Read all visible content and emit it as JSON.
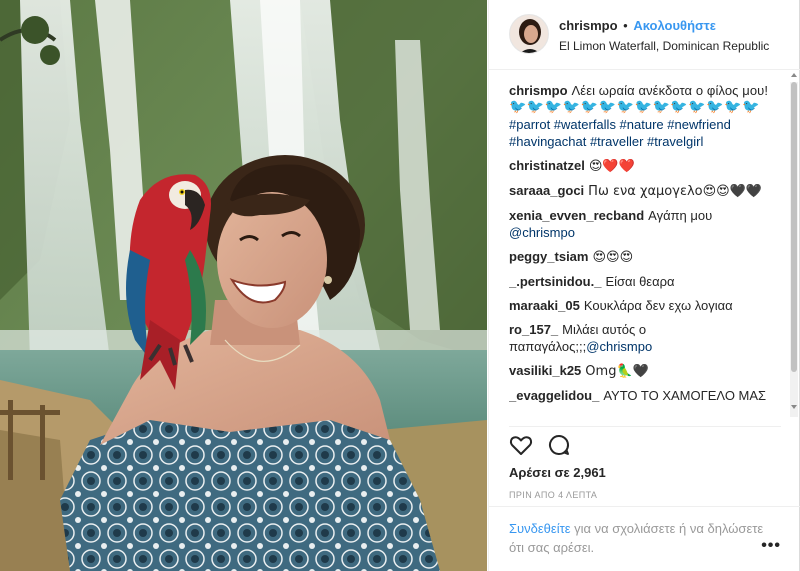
{
  "header": {
    "username": "chrismpo",
    "separator": "•",
    "follow_label": "Ακολουθήστε",
    "location": "El Limon Waterfall, Dominican Republic"
  },
  "caption": {
    "username": "chrismpo",
    "text": "Λέει ωραία ανέκδοτα ο φίλος μου!",
    "emoji_row": "🐦🐦🐦🐦🐦🐦🐦🐦🐦🐦🐦🐦🐦🐦",
    "hashtags": "#parrot #waterfalls #nature #newfriend #havingachat #traveller #travelgirl"
  },
  "comments": [
    {
      "user": "christinatzel",
      "text": "😍❤️❤️"
    },
    {
      "user": "saraaa_goci",
      "text": "Πω ενα χαμογελο😍😍🖤🖤"
    },
    {
      "user": "xenia_evven_recband",
      "text": "Αγάπη μου",
      "mention": "@chrismpo"
    },
    {
      "user": "peggy_tsiam",
      "text": "😍😍😍"
    },
    {
      "user": "_.pertsinidou._",
      "text": "Είσαι θεαρα"
    },
    {
      "user": "maraaki_05",
      "text": "Κουκλάρα δεν εχω λογιαα"
    },
    {
      "user": "ro_157_",
      "text": "Μιλάει αυτός ο παπαγάλος;;;",
      "mention": "@chrismpo"
    },
    {
      "user": "vasiliki_k25",
      "text": "Omg🦜🖤"
    },
    {
      "user": "_evaggelidou_",
      "text": "ΑΥΤΟ ΤΟ ΧΑΜΟΓΕΛΟ ΜΑΣ"
    }
  ],
  "actions": {
    "like_icon": "heart-icon",
    "comment_icon": "comment-icon",
    "likes_text": "Αρέσει σε 2,961",
    "timestamp": "ΠΡΙΝ ΑΠΟ 4 ΛΕΠΤΑ"
  },
  "footer": {
    "login_link": "Συνδεθείτε",
    "login_text": " για να σχολιάσετε ή να δηλώσετε ότι σας αρέσει.",
    "more_label": "•••"
  },
  "colors": {
    "link_blue": "#3897f0",
    "text_dark": "#262626",
    "hashtag_blue": "#003569",
    "muted": "#999999"
  }
}
